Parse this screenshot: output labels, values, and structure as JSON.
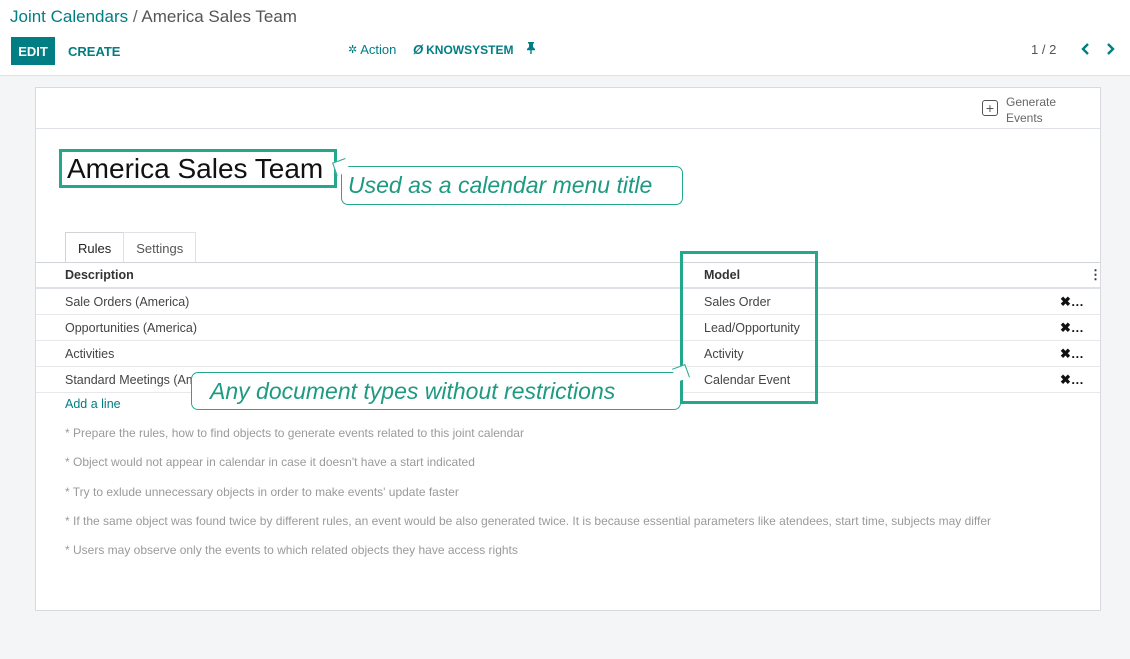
{
  "breadcrumb": {
    "parent": "Joint Calendars",
    "separator": " / ",
    "current": "America Sales Team"
  },
  "toolbar": {
    "edit_label": "EDIT",
    "create_label": "CREATE",
    "action_label": "Action",
    "knowsystem_label": "KNOWSYSTEM",
    "action_icon": "gear-icon",
    "knowsystem_icon": "refresh-icon",
    "pin_icon": "pin-icon"
  },
  "pager": {
    "value": "1 / 2"
  },
  "form": {
    "generate_events_label": "Generate Events",
    "title": "America Sales Team",
    "callout_title": "Used as a calendar menu title",
    "callout_doc": "Any document types without restrictions",
    "tabs": [
      {
        "label": "Rules",
        "active": true
      },
      {
        "label": "Settings",
        "active": false
      }
    ],
    "table": {
      "headers": {
        "description": "Description",
        "model": "Model"
      },
      "rows": [
        {
          "description": "Sale Orders (America)",
          "model": "Sales Order"
        },
        {
          "description": "Opportunities (America)",
          "model": "Lead/Opportunity"
        },
        {
          "description": "Activities",
          "model": "Activity"
        },
        {
          "description": "Standard Meetings (Am",
          "model": "Calendar Event"
        }
      ],
      "delete_symbol": "✖…",
      "add_line_label": "Add a line"
    },
    "notes": [
      "* Prepare the rules, how to find objects to generate events related to this joint calendar",
      "* Object would not appear in calendar in case it doesn't have a start indicated",
      "* Try to exlude unnecessary objects in order to make events' update faster",
      "* If the same object was found twice by different rules, an event would be also generated twice. It is because essential parameters like atendees, start time, subjects may differ",
      "* Users may observe only the events to which related objects they have access rights"
    ]
  },
  "colors": {
    "primary": "#017e84",
    "highlight": "#24a88d"
  }
}
